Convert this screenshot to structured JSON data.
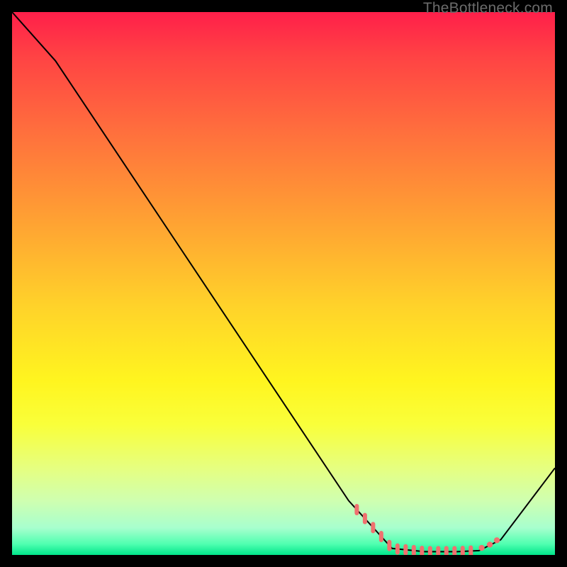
{
  "watermark": "TheBottleneck.com",
  "chart_data": {
    "type": "line",
    "title": "",
    "xlabel": "",
    "ylabel": "",
    "xlim": [
      0,
      100
    ],
    "ylim": [
      0,
      100
    ],
    "grid": false,
    "legend": false,
    "series": [
      {
        "name": "curve",
        "color": "#000000",
        "points": [
          {
            "x": 0,
            "y": 100
          },
          {
            "x": 8,
            "y": 91
          },
          {
            "x": 62,
            "y": 10
          },
          {
            "x": 70,
            "y": 1.2
          },
          {
            "x": 76,
            "y": 0.6
          },
          {
            "x": 82,
            "y": 0.6
          },
          {
            "x": 86,
            "y": 0.8
          },
          {
            "x": 90,
            "y": 2.8
          },
          {
            "x": 100,
            "y": 16
          }
        ]
      }
    ],
    "markers": {
      "color": "#ef716f",
      "ticks_x": [
        63.5,
        65,
        66.5,
        68,
        69.5,
        71,
        72.5,
        74,
        75.5,
        77,
        78.5,
        80,
        81.5,
        83,
        84.5
      ],
      "dots": [
        {
          "x": 86.5,
          "y": 1.3
        },
        {
          "x": 88.0,
          "y": 1.9
        },
        {
          "x": 89.3,
          "y": 2.7
        }
      ]
    },
    "gradient_colors": {
      "top": "#ff1f4a",
      "mid": "#fff51f",
      "bottom": "#00e58a"
    }
  }
}
